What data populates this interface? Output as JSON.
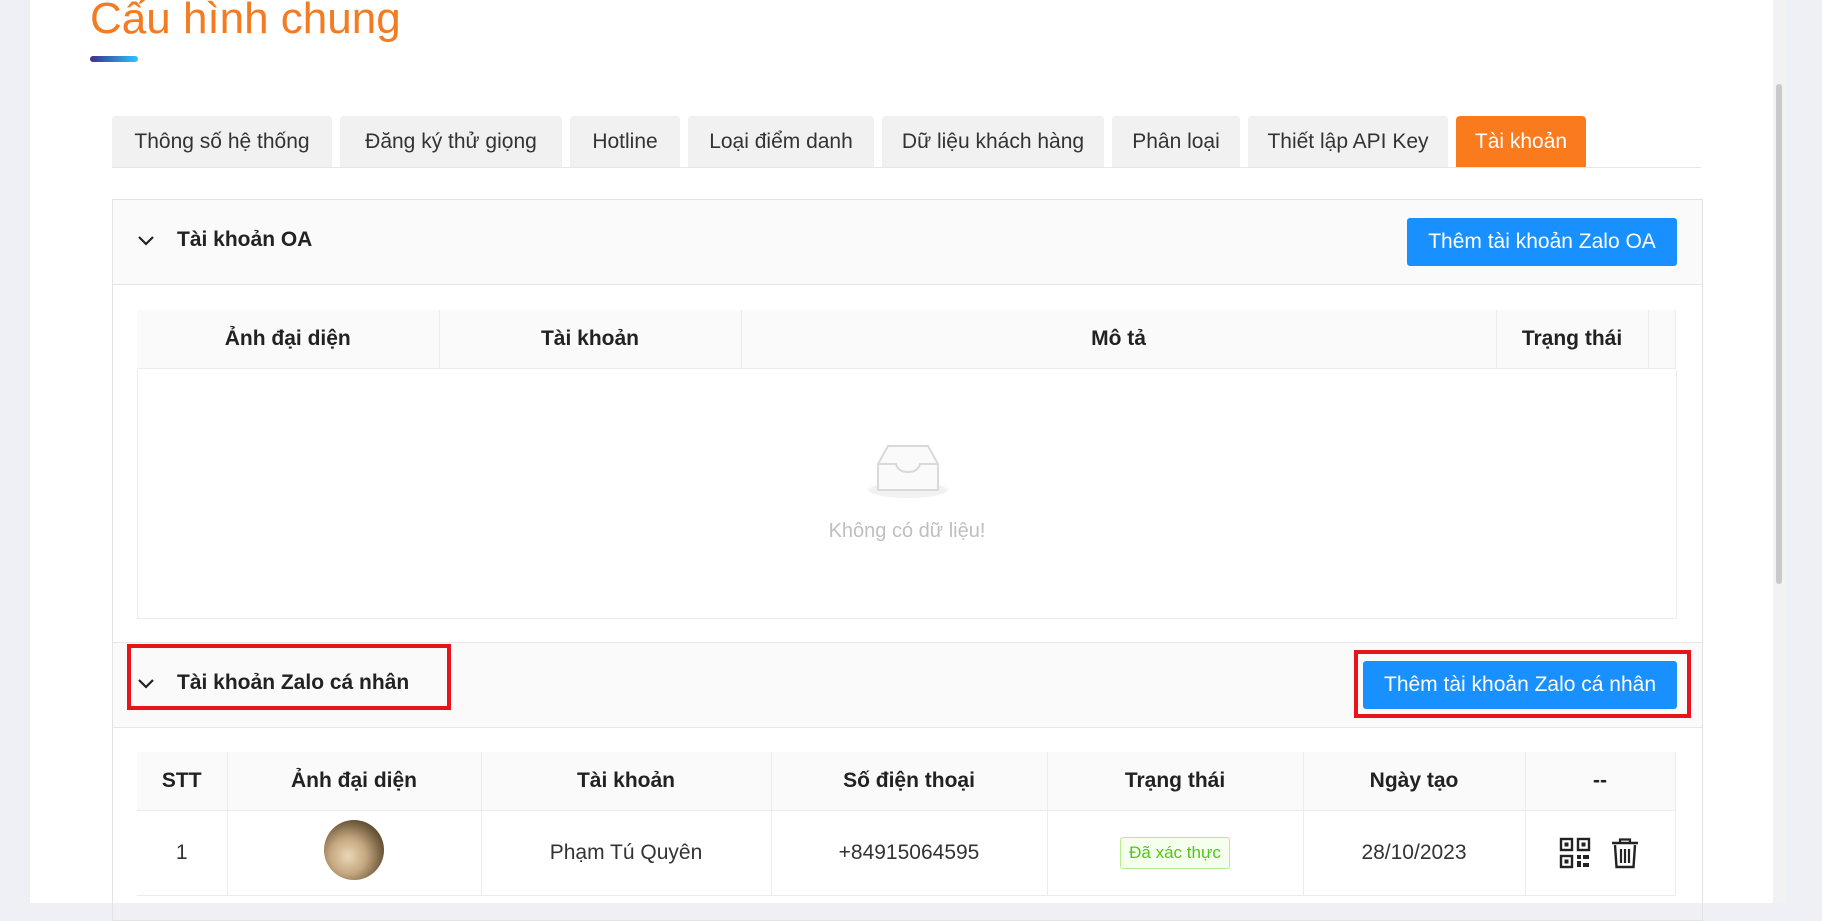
{
  "page": {
    "title": "Cấu hình chung"
  },
  "tabs": [
    {
      "label": "Thông số hệ thống"
    },
    {
      "label": "Đăng ký thử giọng"
    },
    {
      "label": "Hotline"
    },
    {
      "label": "Loại điểm danh"
    },
    {
      "label": "Dữ liệu khách hàng"
    },
    {
      "label": "Phân loại"
    },
    {
      "label": "Thiết lập API Key"
    },
    {
      "label": "Tài khoản",
      "active": true
    }
  ],
  "oa_section": {
    "title": "Tài khoản OA",
    "add_button": "Thêm tài khoản Zalo OA",
    "columns": [
      "Ảnh đại diện",
      "Tài khoản",
      "Mô tả",
      "Trạng thái"
    ],
    "empty_text": "Không có dữ liệu!"
  },
  "personal_section": {
    "title": "Tài khoản Zalo cá nhân",
    "add_button": "Thêm tài khoản Zalo cá nhân",
    "columns": [
      "STT",
      "Ảnh đại diện",
      "Tài khoản",
      "Số điện thoại",
      "Trạng thái",
      "Ngày tạo",
      "--"
    ],
    "rows": [
      {
        "stt": "1",
        "name": "Phạm Tú Quyên",
        "phone": "+84915064595",
        "status": "Đã xác thực",
        "created": "28/10/2023"
      }
    ]
  },
  "colors": {
    "accent": "#f47b20",
    "primary": "#1890ff",
    "highlight": "#e8141c"
  },
  "icons": [
    "chevron-down-icon",
    "empty-inbox-icon",
    "qr-code-icon",
    "trash-icon"
  ]
}
